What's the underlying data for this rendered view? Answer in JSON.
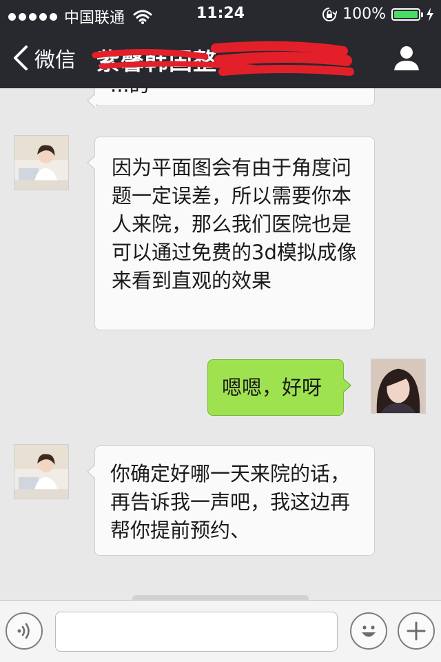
{
  "status_bar": {
    "carrier": "中国联通",
    "time": "11:24",
    "battery": "100%",
    "battery_level": 1.0,
    "icons": [
      "signal-dots-icon",
      "wifi-icon",
      "rotation-lock-icon",
      "battery-icon",
      "charging-bolt-icon"
    ]
  },
  "nav": {
    "back_label": "微信",
    "title": "紫馨韩国整",
    "icons": [
      "chevron-left-icon",
      "user-profile-icon"
    ]
  },
  "messages": [
    {
      "side": "left",
      "text": "...的"
    },
    {
      "side": "left",
      "text": "因为平面图会有由于角度问题一定误差，所以需要你本人来院，那么我们医院也是可以通过免费的3d模拟成像来看到直观的效果"
    },
    {
      "side": "right",
      "text": "嗯嗯，好呀"
    },
    {
      "side": "left",
      "text": "你确定好哪一天来院的话，再告诉我一声吧，我这边再帮你提前预约、"
    }
  ],
  "input": {
    "value": "",
    "icons": [
      "voice-icon",
      "emoji-icon",
      "plus-icon"
    ]
  },
  "colors": {
    "bar_bg": "#27292e",
    "chat_bg": "#e8e8e8",
    "sent_bubble": "#9ee24f",
    "battery_green": "#4cd964",
    "redaction": "#e3202a"
  }
}
